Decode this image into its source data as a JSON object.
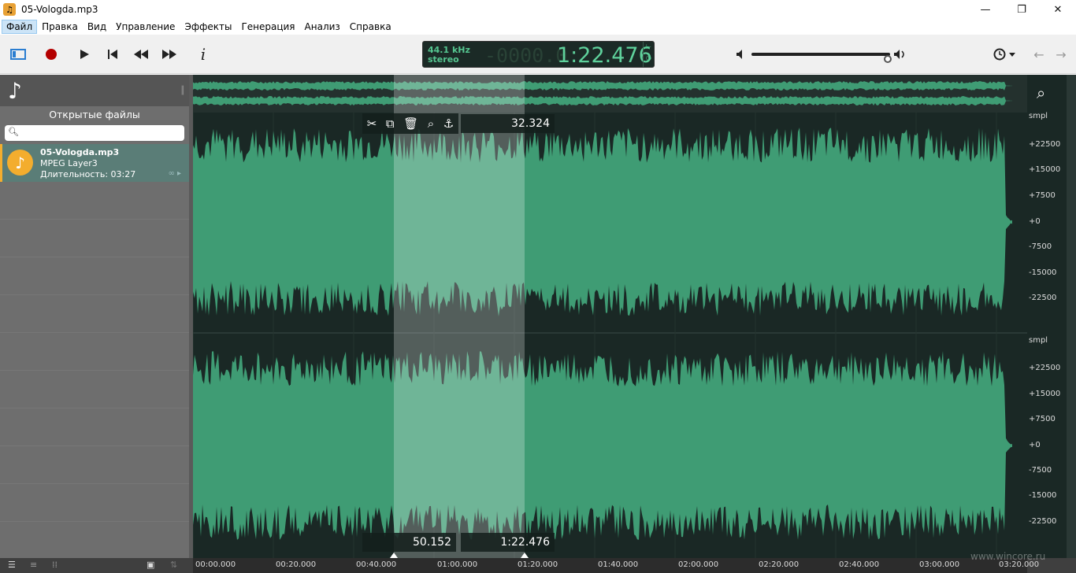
{
  "window": {
    "title": "05-Vologda.mp3",
    "controls": [
      "—",
      "❐",
      "✕"
    ]
  },
  "menu": [
    "Файл",
    "Правка",
    "Вид",
    "Управление",
    "Эффекты",
    "Генерация",
    "Анализ",
    "Справка"
  ],
  "toolbar": {
    "lcd": {
      "rate": "44.1 kHz",
      "channels": "stereo",
      "ghost": "-0000.0",
      "time": "1:22.476"
    }
  },
  "sidebar": {
    "header": "Открытые файлы",
    "search_placeholder": "",
    "file": {
      "name": "05-Vologda.mp3",
      "format": "MPEG Layer3",
      "duration": "Длительность: 03:27"
    }
  },
  "selection": {
    "length": "32.324",
    "start": "50.152",
    "end": "1:22.476"
  },
  "scale_labels": [
    "smpl",
    "+22500",
    "+15000",
    "+7500",
    "+0",
    "-7500",
    "-15000",
    "-22500"
  ],
  "time_ticks": [
    "00:00.000",
    "00:20.000",
    "00:40.000",
    "01:00.000",
    "01:20.000",
    "01:40.000",
    "02:00.000",
    "02:20.000",
    "02:40.000",
    "03:00.000",
    "03:20.000"
  ],
  "watermark": "www.wincore.ru",
  "colors": {
    "wave": "#3f9c74",
    "background": "#1a2825",
    "accent": "#f3ad2e"
  }
}
